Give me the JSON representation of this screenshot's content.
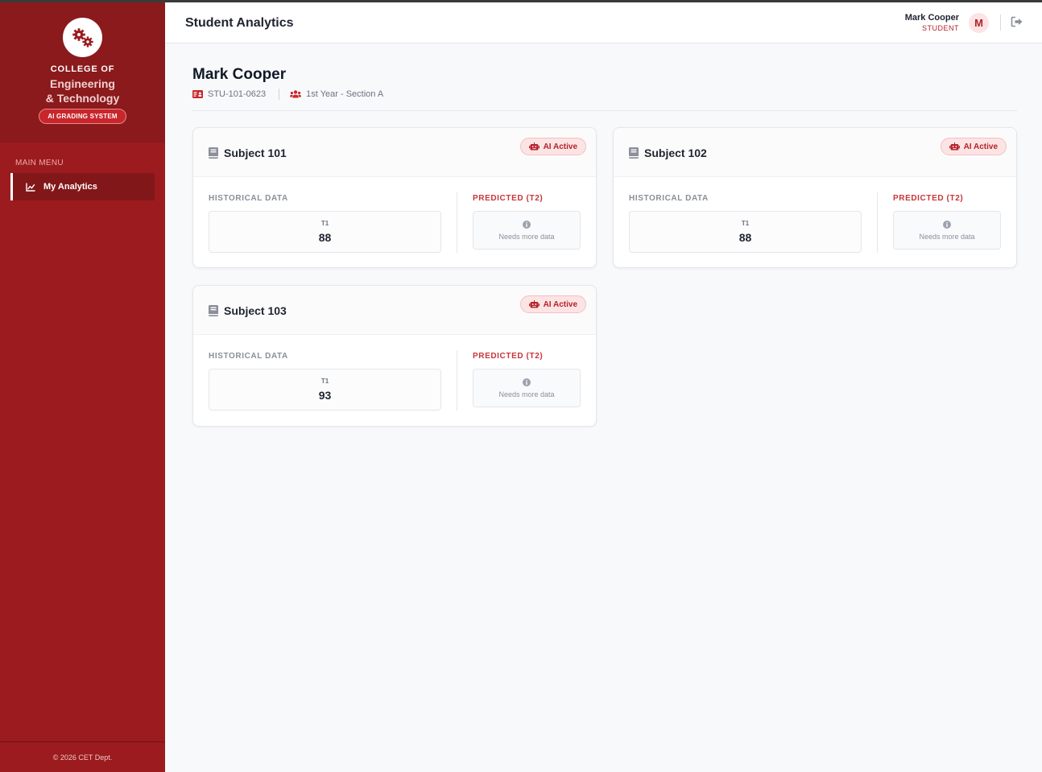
{
  "sidebar": {
    "brand_line1": "COLLEGE OF",
    "brand_line2": "Engineering",
    "brand_line3": "& Technology",
    "brand_badge": "AI GRADING SYSTEM",
    "logo_icon": "gears-icon",
    "menu_heading": "MAIN MENU",
    "menu_items": [
      {
        "label": "My Analytics",
        "icon": "chart-line-icon",
        "active": true
      }
    ],
    "footer": "© 2026 CET Dept."
  },
  "header": {
    "title": "Student Analytics",
    "user_name": "Mark Cooper",
    "user_role": "STUDENT",
    "avatar_initial": "M",
    "logout_icon": "logout-icon"
  },
  "student": {
    "name": "Mark Cooper",
    "id": "STU-101-0623",
    "section": "1st Year - Section A"
  },
  "colors": {
    "sidebar": "#9b1b1e",
    "accent": "#b3222a",
    "pill_bg": "#fde4e4"
  },
  "subjects": [
    {
      "title": "Subject 101",
      "ai_badge": "AI Active",
      "historical_label": "HISTORICAL DATA",
      "predicted_label": "PREDICTED (T2)",
      "term": "T1",
      "value": "88",
      "prediction": "Needs more data"
    },
    {
      "title": "Subject 102",
      "ai_badge": "AI Active",
      "historical_label": "HISTORICAL DATA",
      "predicted_label": "PREDICTED (T2)",
      "term": "T1",
      "value": "88",
      "prediction": "Needs more data"
    },
    {
      "title": "Subject 103",
      "ai_badge": "AI Active",
      "historical_label": "HISTORICAL DATA",
      "predicted_label": "PREDICTED (T2)",
      "term": "T1",
      "value": "93",
      "prediction": "Needs more data"
    }
  ]
}
